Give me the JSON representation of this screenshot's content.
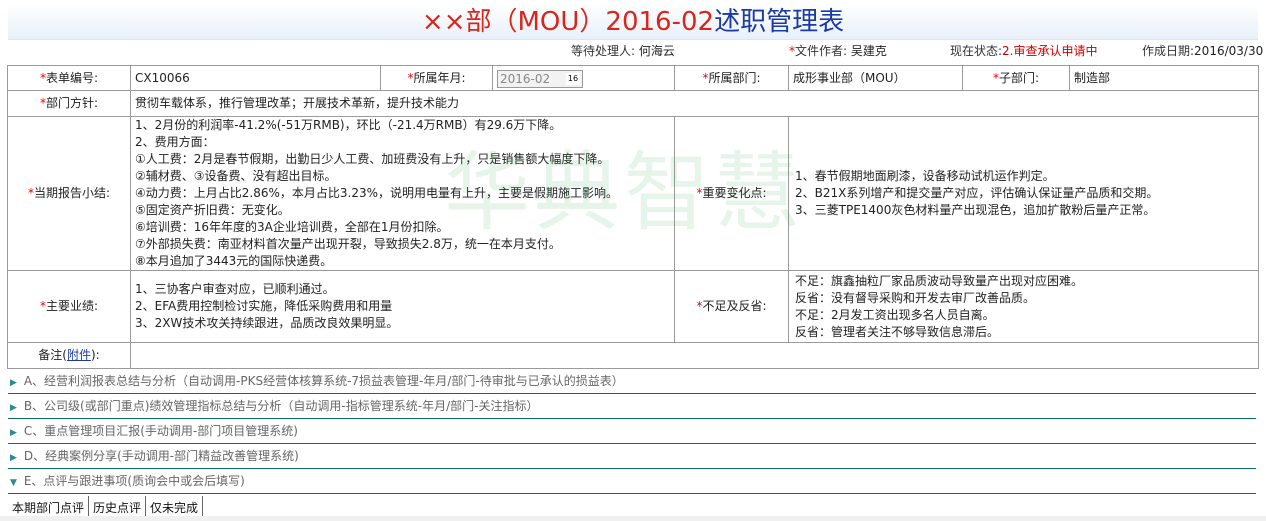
{
  "header": {
    "title_prefix": "××部（MOU）2016-02",
    "title_suffix": "述职管理表"
  },
  "meta": {
    "handler_label": "等待处理人:",
    "handler_value": "何海云",
    "author_label": "文件作者:",
    "author_value": "吴建克",
    "status_label": "现在状态:",
    "status_value": "2.审查承认申请中",
    "date_label": "作成日期:",
    "date_value": "2016/03/30"
  },
  "form": {
    "form_no_label": "表单编号:",
    "form_no_value": "CX10066",
    "month_label": "所属年月:",
    "month_value": "2016-02",
    "calendar_icon_text": "16",
    "dept_label": "所属部门:",
    "dept_value": "成形事业部（MOU）",
    "subdept_label": "子部门:",
    "subdept_value": "制造部",
    "policy_label": "部门方针:",
    "policy_value": "贯彻车载体系，推行管理改革；开展技术革新，提升技术能力",
    "summary_label": "当期报告小结:",
    "summary_lines": [
      "1、2月份的利润率-41.2%(-51万RMB)，环比（-21.4万RMB）有29.6万下降。",
      "2、费用方面：",
      "①人工费：2月是春节假期，出勤日少人工费、加班费没有上升，只是销售额大幅度下降。",
      "②辅材费、③设备费、没有超出目标。",
      "④动力费：上月占比2.86%，本月占比3.23%，说明用电量有上升，主要是假期施工影响。",
      "⑤固定资产折旧费：无变化。",
      "⑥培训费：16年年度的3A企业培训费，全部在1月份扣除。",
      "⑦外部损失费：南亚材料首次量产出现开裂，导致损失2.8万，统一在本月支付。",
      "⑧本月追加了3443元的国际快递费。"
    ],
    "changes_label": "重要变化点:",
    "changes_lines": [
      "1、春节假期地面刷漆，设备移动试机运作判定。",
      "2、B21X系列增产和提交量产对应，评估确认保证量产品质和交期。",
      "3、三菱TPE1400灰色材料量产出现混色，追加扩散粉后量产正常。"
    ],
    "achievements_label": "主要业绩:",
    "achievements_lines": [
      "1、三协客户审查对应，已顺利通过。",
      "2、EFA费用控制检讨实施，降低采购费用和用量",
      "3、2XW技术攻关持续跟进，品质改良效果明显。"
    ],
    "shortfall_label": "不足及反省:",
    "shortfall_lines": [
      "不足：旗鑫抽粒厂家品质波动导致量产出现对应困难。",
      "反省：没有督导采购和开发去审厂改善品质。",
      "不足：2月发工资出现多名人员自离。",
      "反省：管理者关注不够导致信息滞后。"
    ],
    "notes_label": "备注(",
    "notes_link": "附件",
    "notes_label_end": "):"
  },
  "watermark": "华典智慧",
  "sections": [
    "A、经营利润报表总结与分析（自动调用-PKS经营体核算系统-7损益表管理-年月/部门-待审批与已承认的损益表）",
    "B、公司级(或部门重点)绩效管理指标总结与分析（自动调用-指标管理系统-年月/部门-关注指标）",
    "C、重点管理项目汇报(手动调用-部门项目管理系统)",
    "D、经典案例分享(手动调用-部门精益改善管理系统)",
    "E、点评与跟进事项(质询会中或会后填写)"
  ],
  "tabs": [
    "本期部门点评",
    "历史点评",
    "仅未完成"
  ],
  "colors": {
    "title_red": "#d9261c",
    "title_blue": "#1a3aa5",
    "required_star": "#e00000",
    "section_line": "#0f6b6b",
    "watermark_green": "#1b9e3a"
  }
}
